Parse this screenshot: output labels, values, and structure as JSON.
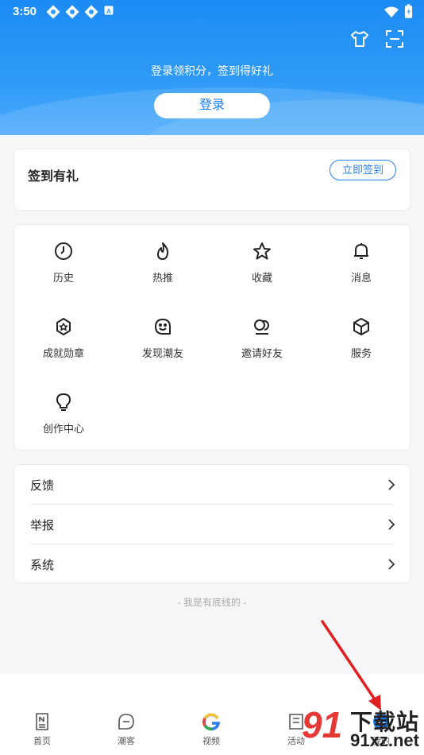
{
  "status_bar": {
    "time": "3:50"
  },
  "header": {
    "login_prompt": "登录领积分，签到得好礼",
    "login_button": "登录",
    "icons": [
      "tshirt-icon",
      "scan-icon"
    ]
  },
  "signin_card": {
    "title": "签到有礼",
    "button": "立即签到"
  },
  "grid": [
    {
      "label": "历史",
      "icon": "clock-icon"
    },
    {
      "label": "热推",
      "icon": "flame-icon"
    },
    {
      "label": "收藏",
      "icon": "star-icon"
    },
    {
      "label": "消息",
      "icon": "bell-icon"
    },
    {
      "label": "成就勋章",
      "icon": "badge-icon"
    },
    {
      "label": "发现潮友",
      "icon": "smile-icon"
    },
    {
      "label": "邀请好友",
      "icon": "invite-icon"
    },
    {
      "label": "服务",
      "icon": "cube-icon"
    },
    {
      "label": "创作中心",
      "icon": "bulb-icon"
    }
  ],
  "list": [
    {
      "label": "反馈"
    },
    {
      "label": "举报"
    },
    {
      "label": "系统"
    }
  ],
  "bottom_note": "- 我是有底线的 -",
  "tabs": [
    {
      "label": "首页",
      "icon": "news-icon"
    },
    {
      "label": "潮客",
      "icon": "chat-icon"
    },
    {
      "label": "视频",
      "icon": "video-logo-icon"
    },
    {
      "label": "活动",
      "icon": "activity-icon"
    },
    {
      "label": "我的",
      "icon": "profile-icon"
    }
  ],
  "watermark": {
    "line1": "下载站",
    "line2": "91xz.net",
    "logo": "91"
  },
  "colors": {
    "primary": "#1a7ef0",
    "header": "#2f9bf7",
    "arrow": "#e02020"
  }
}
